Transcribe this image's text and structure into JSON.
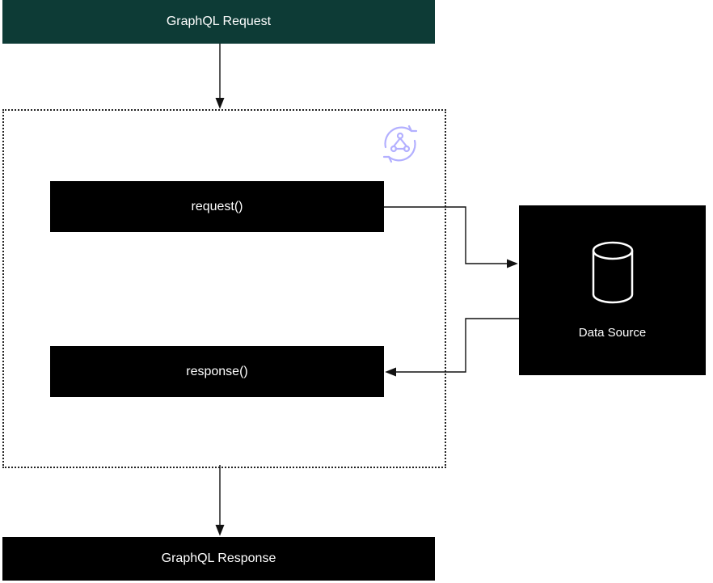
{
  "nodes": {
    "graphql_request": {
      "label": "GraphQL Request"
    },
    "request_fn": {
      "label": "request()"
    },
    "response_fn": {
      "label": "response()"
    },
    "data_source": {
      "label": "Data Source"
    },
    "graphql_response": {
      "label": "GraphQL Response"
    }
  },
  "icons": {
    "resolver_cycle": "resolver-cycle-icon",
    "database": "database-icon"
  },
  "colors": {
    "teal": "#0d3b36",
    "black": "#000000",
    "accent_purple": "#b3b0ff",
    "line": "#111111"
  },
  "flow": {
    "description": "GraphQL Request → resolver container → request() → Data Source → response() → GraphQL Response"
  }
}
